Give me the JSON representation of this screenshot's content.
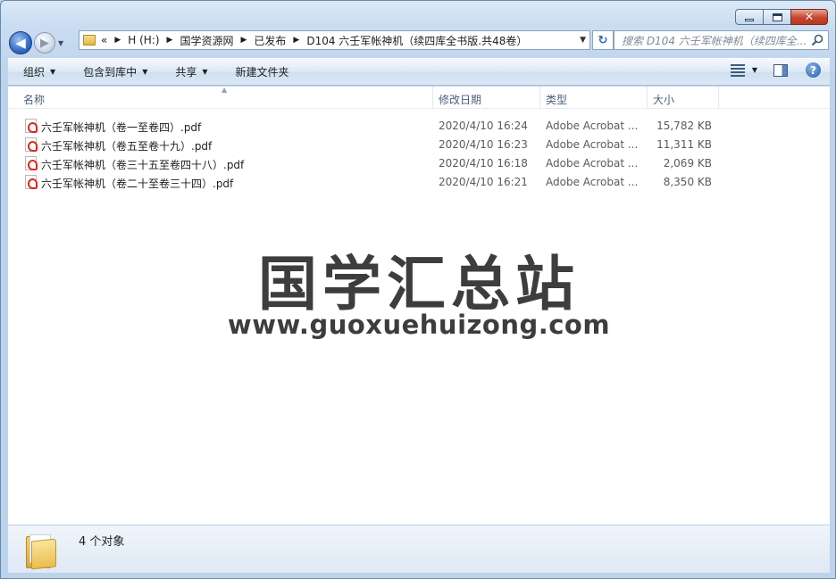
{
  "window": {
    "caption": {
      "minimize": "▁",
      "maximize": "□",
      "close": "✕"
    }
  },
  "nav": {
    "back_glyph": "◀",
    "forward_glyph": "▶",
    "breadcrumb": [
      "«",
      "H (H:)",
      "国学资源网",
      "已发布",
      "D104 六壬军帐神机（续四库全书版.共48卷）"
    ],
    "search_placeholder": "搜索 D104 六壬军帐神机（续四库全..."
  },
  "toolbar": {
    "organize": "组织",
    "include_in_library": "包含到库中",
    "share": "共享",
    "new_folder": "新建文件夹",
    "help": "?"
  },
  "columns": {
    "name": "名称",
    "date": "修改日期",
    "type": "类型",
    "size": "大小"
  },
  "files": [
    {
      "name": "六壬军帐神机（卷一至卷四）.pdf",
      "date": "2020/4/10 16:24",
      "type": "Adobe Acrobat ...",
      "size": "15,782 KB"
    },
    {
      "name": "六壬军帐神机（卷五至卷十九）.pdf",
      "date": "2020/4/10 16:23",
      "type": "Adobe Acrobat ...",
      "size": "11,311 KB"
    },
    {
      "name": "六壬军帐神机（卷三十五至卷四十八）.pdf",
      "date": "2020/4/10 16:18",
      "type": "Adobe Acrobat ...",
      "size": "2,069 KB"
    },
    {
      "name": "六壬军帐神机（卷二十至卷三十四）.pdf",
      "date": "2020/4/10 16:21",
      "type": "Adobe Acrobat ...",
      "size": "8,350 KB"
    }
  ],
  "watermark": {
    "title": "国学汇总站",
    "url": "www.guoxuehuizong.com"
  },
  "status": {
    "count": "4 个对象"
  },
  "icons": {
    "file": "pdf-icon",
    "folder": "folder-icon",
    "search": "search-icon",
    "refresh": "refresh-icon",
    "views": "view-icon",
    "preview": "preview-pane-icon",
    "help": "help-icon"
  },
  "colors": {
    "accent": "#2b6ab8",
    "close": "#c8452c",
    "pdf": "#d42a1e"
  }
}
